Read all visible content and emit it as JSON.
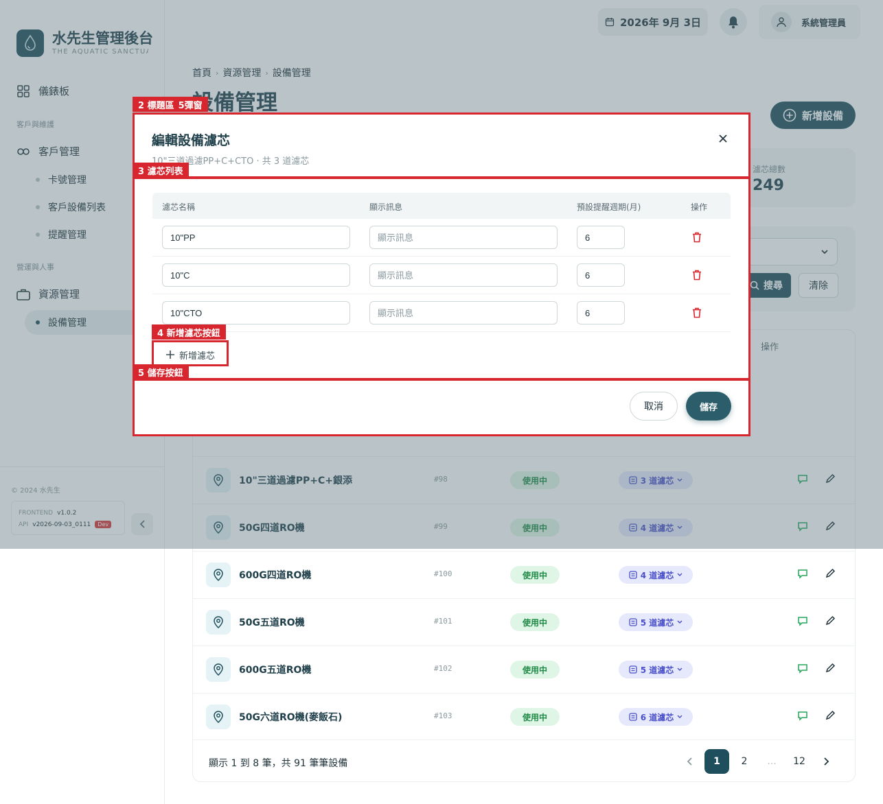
{
  "sidebar": {
    "brand_title": "水先生管理後台",
    "brand_subtitle": "THE AQUATIC SANCTUARY",
    "dashboard": "儀錶板",
    "group_customers": "客戶與維護",
    "customers": "客戶管理",
    "cards": "卡號管理",
    "customer_devices": "客戶設備列表",
    "reminders": "提醒管理",
    "group_operations": "營運與人事",
    "resources": "資源管理",
    "devices": "設備管理",
    "copyright": "© 2024 水先生",
    "frontend_label": "FRONTEND",
    "frontend_version": "v1.0.2",
    "api_label": "API",
    "api_version": "v2026-09-03_0111",
    "env_badge": "Dev"
  },
  "header": {
    "date": "2026年 9月 3日",
    "user": "系統管理員"
  },
  "page": {
    "breadcrumb": [
      "首頁",
      "資源管理",
      "設備管理"
    ],
    "title": "設備管理",
    "add_button": "新增設備",
    "stat_label": "濾芯總數",
    "stat_value": "249",
    "search_button": "搜尋",
    "clear_button": "清除",
    "ops_header": "操作"
  },
  "devices": [
    {
      "name": "10\"三道過濾PP+C+銀添",
      "code": "#98",
      "status": "使用中",
      "filters": "3 道濾芯"
    },
    {
      "name": "50G四道RO機",
      "code": "#99",
      "status": "使用中",
      "filters": "4 道濾芯"
    },
    {
      "name": "600G四道RO機",
      "code": "#100",
      "status": "使用中",
      "filters": "4 道濾芯"
    },
    {
      "name": "50G五道RO機",
      "code": "#101",
      "status": "使用中",
      "filters": "5 道濾芯"
    },
    {
      "name": "600G五道RO機",
      "code": "#102",
      "status": "使用中",
      "filters": "5 道濾芯"
    },
    {
      "name": "50G六道RO機(麥飯石)",
      "code": "#103",
      "status": "使用中",
      "filters": "6 道濾芯"
    }
  ],
  "pagination": {
    "info": "顯示 1 到 8 筆，共 91 筆筆設備",
    "pages": [
      "1",
      "2",
      "...",
      "12"
    ]
  },
  "modal": {
    "title": "編輯設備濾芯",
    "subtitle": "10\"三道過濾PP+C+CTO · 共 3 道濾芯",
    "col_name": "濾芯名稱",
    "col_message": "顯示訊息",
    "col_period": "預設提醒週期(月)",
    "col_ops": "操作",
    "message_placeholder": "顯示訊息",
    "filters": [
      {
        "name": "10\"PP",
        "period": "6"
      },
      {
        "name": "10\"C",
        "period": "6"
      },
      {
        "name": "10\"CTO",
        "period": "6"
      }
    ],
    "add_filter": "新增濾芯",
    "cancel": "取消",
    "save": "儲存"
  },
  "annotations": {
    "header": "2 標題區",
    "header_suffix": "5彈窗",
    "list": "3 濾芯列表",
    "add": "4 新增濾芯按鈕",
    "save": "5 儲存按鈕"
  },
  "colors": {
    "primary": "#1f4f5c",
    "annotation": "#d8262e",
    "status_green": "#1e8a45",
    "badge_indigo": "#4a50c8"
  }
}
